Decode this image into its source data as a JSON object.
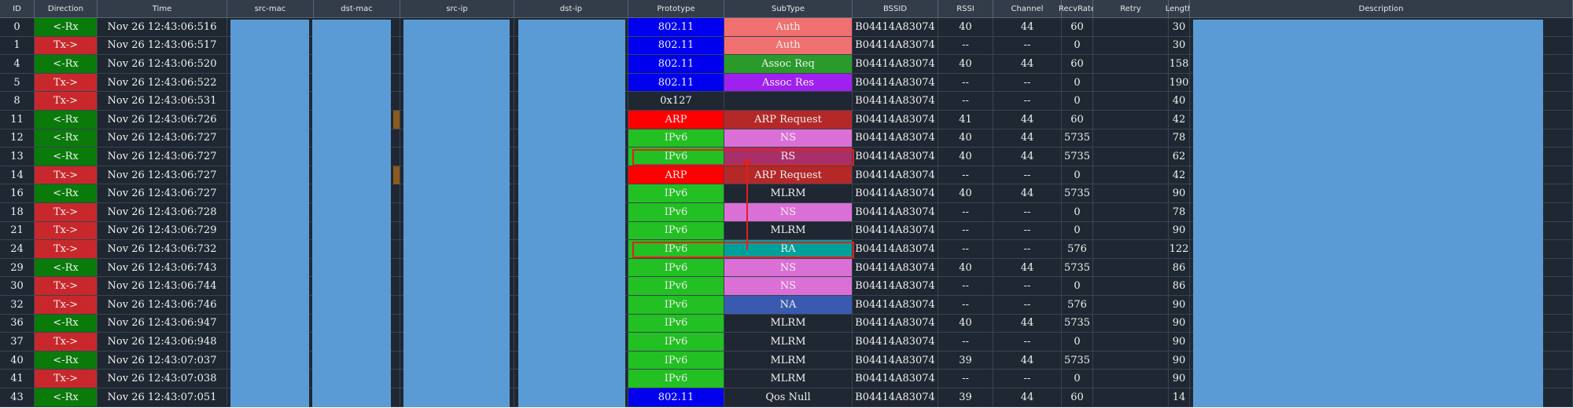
{
  "columns": [
    {
      "key": "id",
      "label": "ID"
    },
    {
      "key": "dir",
      "label": "Direction"
    },
    {
      "key": "time",
      "label": "Time"
    },
    {
      "key": "srcmac",
      "label": "src-mac"
    },
    {
      "key": "dstmac",
      "label": "dst-mac"
    },
    {
      "key": "srcip",
      "label": "src-ip"
    },
    {
      "key": "dstip",
      "label": "dst-ip"
    },
    {
      "key": "proto",
      "label": "Prototype"
    },
    {
      "key": "sub",
      "label": "SubType"
    },
    {
      "key": "bssid",
      "label": "BSSID"
    },
    {
      "key": "rssi",
      "label": "RSSI"
    },
    {
      "key": "chan",
      "label": "Channel"
    },
    {
      "key": "recv",
      "label": "RecvRate"
    },
    {
      "key": "retry",
      "label": "Retry"
    },
    {
      "key": "len",
      "label": "Length"
    },
    {
      "key": "desc",
      "label": "Description"
    }
  ],
  "colors": {
    "rx": "#0a7a0a",
    "tx": "#c8282c",
    "row_bg": "#1f2732",
    "proto_80211": "#0000ee",
    "proto_ipv6": "#22c022",
    "proto_arp": "#ff0000",
    "sub_auth": "#f07070",
    "sub_assocreq": "#2a9a2a",
    "sub_assocres": "#a020f0",
    "sub_arp": "#b52828",
    "sub_ns": "#da70d6",
    "sub_rs": "#a8306a",
    "sub_ra": "#00a09a",
    "sub_na": "#3a5ab0",
    "masked": "#5b9bd5",
    "highlight": "#e02020"
  },
  "rows": [
    {
      "id": "0",
      "dir": "<-Rx",
      "time": "Nov 26 12:43:06:516",
      "proto": "802.11",
      "sub": "Auth",
      "bssid": "B04414A83074",
      "rssi": "40",
      "chan": "44",
      "recv": "60",
      "retry": "",
      "len": "30"
    },
    {
      "id": "1",
      "dir": "Tx->",
      "time": "Nov 26 12:43:06:517",
      "proto": "802.11",
      "sub": "Auth",
      "bssid": "B04414A83074",
      "rssi": "--",
      "chan": "--",
      "recv": "0",
      "retry": "",
      "len": "30"
    },
    {
      "id": "4",
      "dir": "<-Rx",
      "time": "Nov 26 12:43:06:520",
      "proto": "802.11",
      "sub": "Assoc Req",
      "bssid": "B04414A83074",
      "rssi": "40",
      "chan": "44",
      "recv": "60",
      "retry": "",
      "len": "158"
    },
    {
      "id": "5",
      "dir": "Tx->",
      "time": "Nov 26 12:43:06:522",
      "proto": "802.11",
      "sub": "Assoc Res",
      "bssid": "B04414A83074",
      "rssi": "--",
      "chan": "--",
      "recv": "0",
      "retry": "",
      "len": "190"
    },
    {
      "id": "8",
      "dir": "Tx->",
      "time": "Nov 26 12:43:06:531",
      "proto": "0x127",
      "sub": "",
      "bssid": "B04414A83074",
      "rssi": "--",
      "chan": "--",
      "recv": "0",
      "retry": "",
      "len": "40"
    },
    {
      "id": "11",
      "dir": "<-Rx",
      "time": "Nov 26 12:43:06:726",
      "proto": "ARP",
      "sub": "ARP Request",
      "bssid": "B04414A83074",
      "rssi": "41",
      "chan": "44",
      "recv": "60",
      "retry": "",
      "len": "42"
    },
    {
      "id": "12",
      "dir": "<-Rx",
      "time": "Nov 26 12:43:06:727",
      "proto": "IPv6",
      "sub": "NS",
      "bssid": "B04414A83074",
      "rssi": "40",
      "chan": "44",
      "recv": "5735",
      "retry": "",
      "len": "78"
    },
    {
      "id": "13",
      "dir": "<-Rx",
      "time": "Nov 26 12:43:06:727",
      "proto": "IPv6",
      "sub": "RS",
      "bssid": "B04414A83074",
      "rssi": "40",
      "chan": "44",
      "recv": "5735",
      "retry": "",
      "len": "62"
    },
    {
      "id": "14",
      "dir": "Tx->",
      "time": "Nov 26 12:43:06:727",
      "proto": "ARP",
      "sub": "ARP Request",
      "bssid": "B04414A83074",
      "rssi": "--",
      "chan": "--",
      "recv": "0",
      "retry": "",
      "len": "42"
    },
    {
      "id": "16",
      "dir": "<-Rx",
      "time": "Nov 26 12:43:06:727",
      "proto": "IPv6",
      "sub": "MLRM",
      "bssid": "B04414A83074",
      "rssi": "40",
      "chan": "44",
      "recv": "5735",
      "retry": "",
      "len": "90"
    },
    {
      "id": "18",
      "dir": "Tx->",
      "time": "Nov 26 12:43:06:728",
      "proto": "IPv6",
      "sub": "NS",
      "bssid": "B04414A83074",
      "rssi": "--",
      "chan": "--",
      "recv": "0",
      "retry": "",
      "len": "78"
    },
    {
      "id": "21",
      "dir": "Tx->",
      "time": "Nov 26 12:43:06:729",
      "proto": "IPv6",
      "sub": "MLRM",
      "bssid": "B04414A83074",
      "rssi": "--",
      "chan": "--",
      "recv": "0",
      "retry": "",
      "len": "90"
    },
    {
      "id": "24",
      "dir": "Tx->",
      "time": "Nov 26 12:43:06:732",
      "proto": "IPv6",
      "sub": "RA",
      "bssid": "B04414A83074",
      "rssi": "--",
      "chan": "--",
      "recv": "576",
      "retry": "",
      "len": "122"
    },
    {
      "id": "29",
      "dir": "<-Rx",
      "time": "Nov 26 12:43:06:743",
      "proto": "IPv6",
      "sub": "NS",
      "bssid": "B04414A83074",
      "rssi": "40",
      "chan": "44",
      "recv": "5735",
      "retry": "",
      "len": "86"
    },
    {
      "id": "30",
      "dir": "Tx->",
      "time": "Nov 26 12:43:06:744",
      "proto": "IPv6",
      "sub": "NS",
      "bssid": "B04414A83074",
      "rssi": "--",
      "chan": "--",
      "recv": "0",
      "retry": "",
      "len": "86"
    },
    {
      "id": "32",
      "dir": "Tx->",
      "time": "Nov 26 12:43:06:746",
      "proto": "IPv6",
      "sub": "NA",
      "bssid": "B04414A83074",
      "rssi": "--",
      "chan": "--",
      "recv": "576",
      "retry": "",
      "len": "90"
    },
    {
      "id": "36",
      "dir": "<-Rx",
      "time": "Nov 26 12:43:06:947",
      "proto": "IPv6",
      "sub": "MLRM",
      "bssid": "B04414A83074",
      "rssi": "40",
      "chan": "44",
      "recv": "5735",
      "retry": "",
      "len": "90"
    },
    {
      "id": "37",
      "dir": "Tx->",
      "time": "Nov 26 12:43:06:948",
      "proto": "IPv6",
      "sub": "MLRM",
      "bssid": "B04414A83074",
      "rssi": "--",
      "chan": "--",
      "recv": "0",
      "retry": "",
      "len": "90"
    },
    {
      "id": "40",
      "dir": "<-Rx",
      "time": "Nov 26 12:43:07:037",
      "proto": "IPv6",
      "sub": "MLRM",
      "bssid": "B04414A83074",
      "rssi": "39",
      "chan": "44",
      "recv": "5735",
      "retry": "",
      "len": "90"
    },
    {
      "id": "41",
      "dir": "Tx->",
      "time": "Nov 26 12:43:07:038",
      "proto": "IPv6",
      "sub": "MLRM",
      "bssid": "B04414A83074",
      "rssi": "--",
      "chan": "--",
      "recv": "0",
      "retry": "",
      "len": "90"
    },
    {
      "id": "43",
      "dir": "<-Rx",
      "time": "Nov 26 12:43:07:051",
      "proto": "802.11",
      "sub": "Qos Null",
      "bssid": "B04414A83074",
      "rssi": "39",
      "chan": "44",
      "recv": "60",
      "retry": "",
      "len": "14"
    }
  ],
  "highlighted_row_ids": [
    "13",
    "24"
  ]
}
